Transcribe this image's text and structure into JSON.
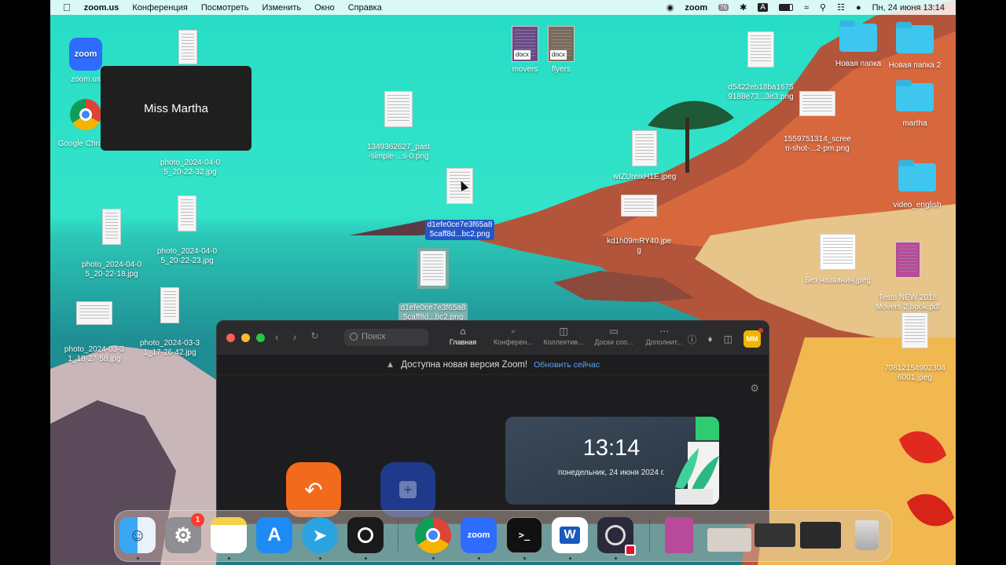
{
  "menubar": {
    "app": "zoom.us",
    "menus": [
      "Конференция",
      "Посмотреть",
      "Изменить",
      "Окно",
      "Справка"
    ],
    "zoom_status": "zoom",
    "datetime": "Пн, 24 июня  13:14",
    "keyboard": "A",
    "badge_temp": "76"
  },
  "desktop": {
    "left_icons": {
      "zoom_app": "zoom.us",
      "zoom_logo": "zoom",
      "chrome": "Google Chrome"
    },
    "name_overlay": "Miss Martha",
    "files": {
      "f1": "photo_2024-04-0\n5_20-22-32.jpg",
      "f2": "1349362627_past\n-simple-...s-0.png",
      "f3": "movers",
      "f4": "flyers",
      "f5": "d5422eb18ba1675\n9188e73...3e3.png",
      "f6": "Новая папка",
      "f7": "Новая папка 2",
      "f8": "martha",
      "f9": "1559751314_scree\nn-shot-...2-pm.png",
      "f10": "wIZUreixH1E.jpeg",
      "f11": "d1efe0ce7e3f65a8\n5caff8d...bc2.png",
      "f12": "kd1h09mRY40.jpe\ng",
      "f13": "video_english",
      "f14": "photo_2024-04-0\n5_20-22-18.jpg",
      "f15": "photo_2024-04-0\n5_20-22-23.jpg",
      "f16": "d1efe0ce7e3f65a8\n5caff8d...bc2.png",
      "f17": "Без названия.jpeg",
      "f18": "Tests NEW 2018\nMovers 2 book.pdf",
      "f19": "photo_2024-03-3\n1_18-27-58.jpg",
      "f20": "photo_2024-03-3\n1_17-26-42.jpg",
      "f21": "70812154902304\n6001.jpeg"
    },
    "docx_tag": "docx"
  },
  "zoom_window": {
    "search_placeholder": "Поиск",
    "tabs": [
      {
        "label": "Главная",
        "icon": "home-icon"
      },
      {
        "label": "Конферен...",
        "icon": "video-icon"
      },
      {
        "label": "Коллектив...",
        "icon": "chat-icon"
      },
      {
        "label": "Доски соо...",
        "icon": "whiteboard-icon"
      },
      {
        "label": "Дополнит...",
        "icon": "more-icon"
      }
    ],
    "avatar": "MM",
    "banner_text": "Доступна новая версия Zoom!",
    "banner_link": "Обновить сейчас",
    "clock_time": "13:14",
    "clock_date": "понедельник, 24 июня 2024 г."
  },
  "dock": {
    "settings_badge": "1",
    "zoom_label": "zoom",
    "word_label": "W"
  },
  "colors": {
    "selection": "#2456c8",
    "zoom_blue": "#2d6cff",
    "new_meeting_orange": "#f26a1b",
    "join_blue": "#1f3a8a"
  }
}
